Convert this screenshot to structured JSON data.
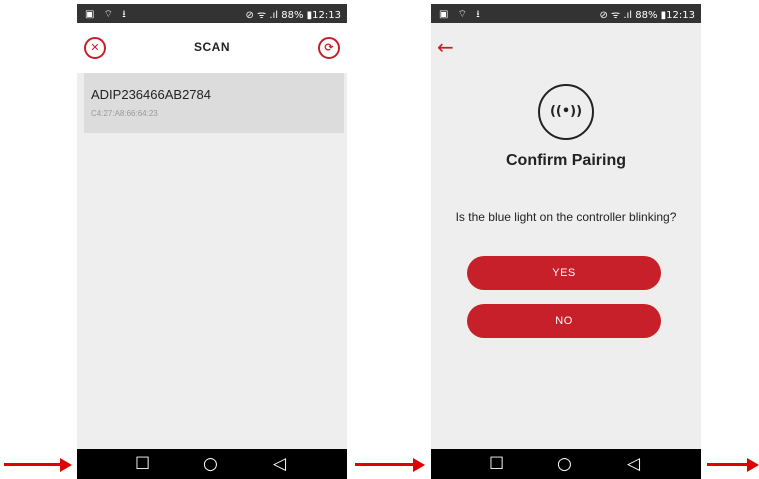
{
  "scan_screen": {
    "status": {
      "left_icons": "▣ ⌔ ⭳",
      "right_text": "⊘ ᯤ .ıl 88% ▮12:13"
    },
    "header": {
      "title": "SCAN",
      "close_icon": "✕",
      "refresh_icon": "⟳"
    },
    "device": {
      "name": "ADIP236466AB2784",
      "mac": "C4:27:A8:66:64:23"
    },
    "nav": {
      "recent": "☐",
      "home": "○",
      "back": "◁"
    }
  },
  "pair_screen": {
    "status": {
      "left_icons": "▣ ⌔ ⭳",
      "right_text": "⊘ ᯤ .ıl 88% ▮12:13"
    },
    "back_icon": "←",
    "pair_icon": "((•))",
    "title": "Confirm Pairing",
    "question": "Is the blue light on the controller blinking?",
    "yes_label": "YES",
    "no_label": "NO",
    "nav": {
      "recent": "☐",
      "home": "○",
      "back": "◁"
    }
  },
  "colors": {
    "accent": "#c8202a",
    "arrow": "#e00000",
    "screen_bg": "#eeeeee",
    "device_row_bg": "#dcdcdc"
  }
}
